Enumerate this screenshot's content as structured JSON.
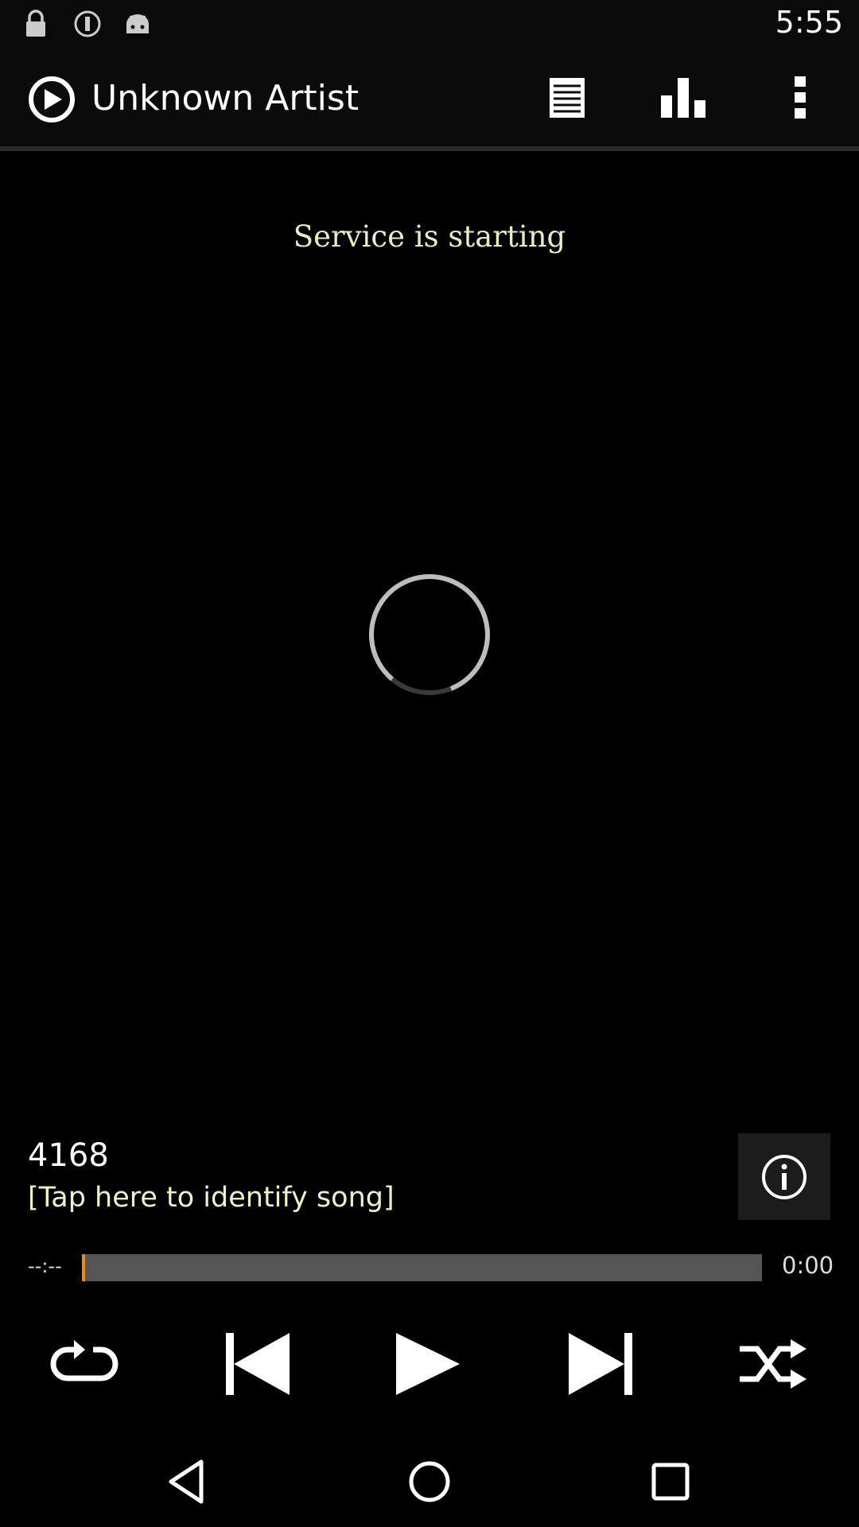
{
  "status_bar": {
    "time": "5:55",
    "icons": [
      "lock-icon",
      "alert-icon",
      "android-icon"
    ]
  },
  "app_bar": {
    "title": "Unknown Artist",
    "actions": [
      "playlist-icon",
      "equalizer-icon",
      "more-vert-icon"
    ]
  },
  "main": {
    "service_status": "Service is starting",
    "track_number": "4168",
    "identify_prompt": "[Tap here to identify song]"
  },
  "seek": {
    "elapsed": "--:--",
    "total": "0:00",
    "progress": 0.005
  },
  "controls": [
    "repeat-icon",
    "previous-icon",
    "play-icon",
    "next-icon",
    "shuffle-icon"
  ],
  "nav": [
    "back-icon",
    "home-icon",
    "recents-icon"
  ],
  "colors": {
    "accent": "#e88b1e",
    "status_text": "#e5eec0"
  }
}
